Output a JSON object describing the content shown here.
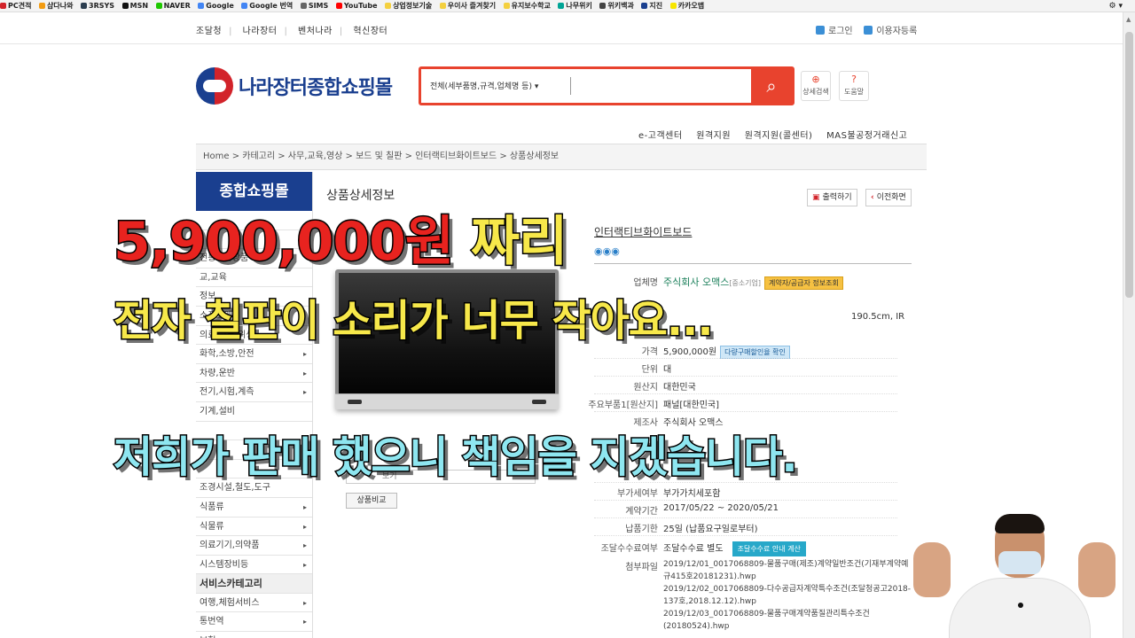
{
  "bookmarks": {
    "items": [
      "PC견적",
      "샵다나와",
      "3RSYS",
      "MSN",
      "NAVER",
      "Google",
      "Google 번역",
      "SIMS",
      "YouTube",
      "상업정보기술",
      "우이사 즐겨찾기",
      "유지보수학교",
      "나무위키",
      "위키백과",
      "지진",
      "카카오맵"
    ]
  },
  "topbar": {
    "links": [
      "조달청",
      "나라장터",
      "벤처나라",
      "혁신장터"
    ],
    "login": "로그인",
    "register": "이용자등록"
  },
  "logo": {
    "text": "나라장터종합쇼핑몰"
  },
  "search": {
    "category": "전체(세부품명,규격,업체명 등)",
    "value": "",
    "detail_label": "상세검색",
    "help_label": "도움말"
  },
  "gnb": {
    "items": [
      "e-고객센터",
      "원격지원",
      "원격지원(콜센터)",
      "MAS불공정거래신고"
    ]
  },
  "breadcrumb": {
    "text": "Home > 카테고리 > 사무,교육,영상 > 보드 및 칠판 > 인터랙티브화이트보드 > 상품상세정보"
  },
  "leftnav": {
    "title": "종합쇼핑몰",
    "items": [
      {
        "label": "",
        "arrow": false
      },
      {
        "label": "",
        "arrow": false
      },
      {
        "label": "전통문화상품",
        "arrow": false
      },
      {
        "label": "교,교육",
        "arrow": false
      },
      {
        "label": "정보",
        "arrow": false
      },
      {
        "label": "소프트웨어",
        "arrow": false
      },
      {
        "label": "의료,고무,위생",
        "arrow": false
      },
      {
        "label": "화학,소방,안전",
        "arrow": true
      },
      {
        "label": "차량,운반",
        "arrow": true
      },
      {
        "label": "전기,시험,계측",
        "arrow": true
      },
      {
        "label": "기계,설비",
        "arrow": false
      },
      {
        "label": "",
        "arrow": false
      },
      {
        "label": "",
        "arrow": false
      },
      {
        "label": "",
        "arrow": false
      },
      {
        "label": "조경시설,철도,도구",
        "arrow": false
      },
      {
        "label": "식품류",
        "arrow": true
      },
      {
        "label": "식물류",
        "arrow": true
      },
      {
        "label": "의료기기,의약품",
        "arrow": true
      },
      {
        "label": "시스템장비등",
        "arrow": true
      },
      {
        "label": "서비스카테고리",
        "arrow": false,
        "header": true
      },
      {
        "label": "여행,체험서비스",
        "arrow": true
      },
      {
        "label": "통번역",
        "arrow": true
      },
      {
        "label": "보험",
        "arrow": true
      }
    ]
  },
  "content": {
    "title": "상품상세정보",
    "print_label": "출력하기",
    "prev_label": "이전화면",
    "product_name": "인터랙티브화이트보드",
    "compare_label": "상품비교",
    "compare_placeholder": "보기"
  },
  "specs": {
    "vendor_label": "업체명",
    "vendor": "주식회사 오맥스",
    "vendor_type": "[중소기업]",
    "vendor_btn": "계약자/공급자 정보조회",
    "size_frag": "190.5cm, IR",
    "price_label": "가격",
    "price": "5,900,000원",
    "discount_btn": "다량구매할인율 확인",
    "unit_label": "단위",
    "unit": "대",
    "origin_label": "원산지",
    "origin": "대한민국",
    "part_label": "주요부품1[원산지]",
    "part": "패널[대한민국]",
    "maker_label": "제조사",
    "maker": "주식회사 오맥스",
    "vat_label": "부가세여부",
    "vat": "부가가치세포함",
    "period_label": "계약기간",
    "period": "2017/05/22 ~ 2020/05/21",
    "delivery_label": "납품기한",
    "delivery": "25일 (납품요구일로부터)",
    "fee_label": "조달수수료여부",
    "fee": "조달수수료 별도",
    "fee_btn": "조달수수료 안내 계산",
    "attach_label": "첨부파일",
    "attachments": [
      "2019/12/01_0017068809-물품구매(제조)계약일반조건(기재부계약예규415호20181231).hwp",
      "2019/12/02_0017068809-다수공급자계약특수조건(조달청공고2018-137호,2018.12.12).hwp",
      "2019/12/03_0017068809-물품구매계약품질관리특수조건(20180524).hwp"
    ]
  },
  "captions": {
    "line1_price": "5,900,000원",
    "line1_rest": " 짜리",
    "line2": "전자 칠판이 소리가 너무 작아요...",
    "line3": "저희가 판매 했으니 책임을 지겠습니다."
  },
  "colors": {
    "brand": "#1a3f8f",
    "accent": "#e8432e",
    "caption_red": "#e8231f",
    "caption_yellow": "#f7e84a",
    "caption_cyan": "#8ee6f0"
  }
}
